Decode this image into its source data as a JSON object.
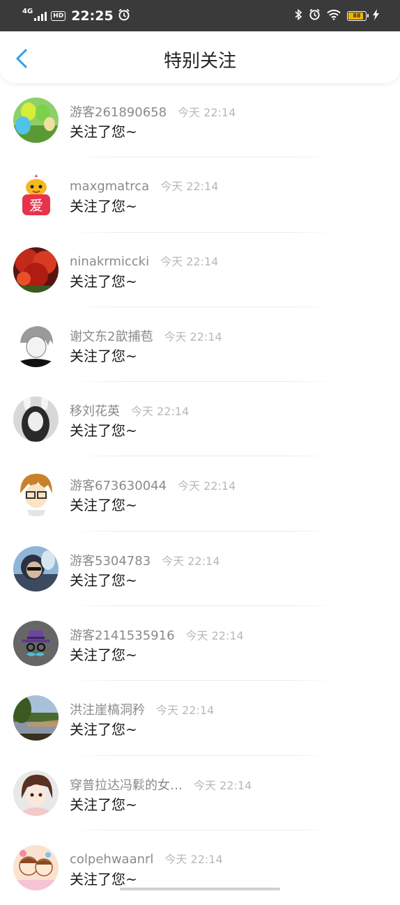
{
  "status_bar": {
    "network": "4G",
    "hd": "HD",
    "time": "22:25",
    "battery": "88",
    "battery_color": "#f2b400"
  },
  "header": {
    "title": "特别关注",
    "back_icon": "chevron-left-icon",
    "accent_color": "#2a9fe6"
  },
  "items": [
    {
      "name": "游客261890658",
      "time": "今天 22:14",
      "message": "关注了您~",
      "avatar": "balloons-avatar"
    },
    {
      "name": "maxgmatrca",
      "time": "今天 22:14",
      "message": "关注了您~",
      "avatar": "love-character-avatar"
    },
    {
      "name": "ninakrmiccki",
      "time": "今天 22:14",
      "message": "关注了您~",
      "avatar": "red-tree-avatar"
    },
    {
      "name": "谢文东2歆捕苞",
      "time": "今天 22:14",
      "message": "关注了您~",
      "avatar": "anime-boy-avatar"
    },
    {
      "name": "移刘花英",
      "time": "今天 22:14",
      "message": "关注了您~",
      "avatar": "girl-bunny-ears-avatar"
    },
    {
      "name": "游客673630044",
      "time": "今天 22:14",
      "message": "关注了您~",
      "avatar": "cartoon-glasses-avatar"
    },
    {
      "name": "游客5304783",
      "time": "今天 22:14",
      "message": "关注了您~",
      "avatar": "sunglasses-man-avatar"
    },
    {
      "name": "游客2141535916",
      "time": "今天 22:14",
      "message": "关注了您~",
      "avatar": "hat-mustache-avatar"
    },
    {
      "name": "洪注崖槁洞矜",
      "time": "今天 22:14",
      "message": "关注了您~",
      "avatar": "lake-landscape-avatar"
    },
    {
      "name": "穿普拉达冯鬏的女…",
      "time": "今天 22:14",
      "message": "关注了您~",
      "avatar": "anime-girl-avatar"
    },
    {
      "name": "colpehwaanrl",
      "time": "今天 22:14",
      "message": "关注了您~",
      "avatar": "cute-cartoon-avatar"
    }
  ]
}
